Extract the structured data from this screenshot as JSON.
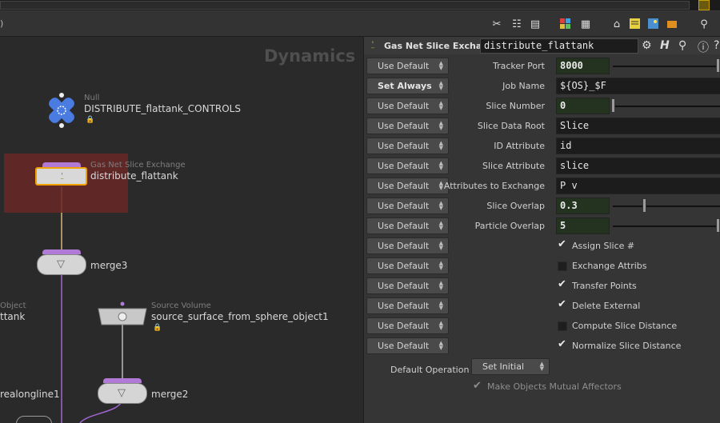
{
  "network": {
    "context_label": "Dynamics",
    "nodes": [
      {
        "type": "Null",
        "name": "DISTRIBUTE_flattank_CONTROLS"
      },
      {
        "type": "Gas Net Slice Exchange",
        "name": "distribute_flattank"
      },
      {
        "type": "",
        "name": "merge3"
      },
      {
        "type": "Object",
        "name": "ttank"
      },
      {
        "type": "Source Volume",
        "name": "source_surface_from_sphere_object1"
      },
      {
        "type": "",
        "name": "merge2"
      },
      {
        "type": "",
        "name": "realongline1"
      }
    ]
  },
  "param_header": {
    "node_type": "Gas Net Slice Exchange",
    "node_name": "distribute_flattank"
  },
  "params": [
    {
      "button": "Use Default",
      "label": "Tracker Port",
      "value": "8000",
      "kind": "int_slider",
      "slider_fraction": 1.0
    },
    {
      "button": "Set Always",
      "label": "Job Name",
      "value": "${OS}_$F",
      "kind": "string"
    },
    {
      "button": "Use Default",
      "label": "Slice Number",
      "value": "0",
      "kind": "int_slider",
      "slider_fraction": 0.0
    },
    {
      "button": "Use Default",
      "label": "Slice Data Root",
      "value": "Slice",
      "kind": "string"
    },
    {
      "button": "Use Default",
      "label": "ID Attribute",
      "value": "id",
      "kind": "string"
    },
    {
      "button": "Use Default",
      "label": "Slice Attribute",
      "value": "slice",
      "kind": "string"
    },
    {
      "button": "Use Default",
      "label": "Attributes to Exchange",
      "value": "P v",
      "kind": "string"
    },
    {
      "button": "Use Default",
      "label": "Slice Overlap",
      "value": "0.3",
      "kind": "float_slider",
      "slider_fraction": 0.3
    },
    {
      "button": "Use Default",
      "label": "Particle Overlap",
      "value": "5",
      "kind": "int_slider",
      "slider_fraction": 1.0
    },
    {
      "button": "Use Default",
      "label": "Assign Slice #",
      "checked": true,
      "kind": "toggle"
    },
    {
      "button": "Use Default",
      "label": "Exchange Attribs",
      "checked": false,
      "kind": "toggle"
    },
    {
      "button": "Use Default",
      "label": "Transfer Points",
      "checked": true,
      "kind": "toggle"
    },
    {
      "button": "Use Default",
      "label": "Delete External",
      "checked": true,
      "kind": "toggle"
    },
    {
      "button": "Use Default",
      "label": "Compute Slice Distance",
      "checked": false,
      "kind": "toggle"
    },
    {
      "button": "Use Default",
      "label": "Normalize Slice Distance",
      "checked": true,
      "kind": "toggle"
    }
  ],
  "default_operation": {
    "label": "Default Operation",
    "value": "Set Initial"
  },
  "mutual_affectors": {
    "label": "Make Objects Mutual Affectors",
    "checked": true
  },
  "colors": {
    "selection_highlight": "#6a2727",
    "node_purple": "#b07ad6",
    "wire_purple": "#a066d0",
    "wire_orange": "#d8b27a",
    "selected_node_outline": "#f0a000"
  }
}
